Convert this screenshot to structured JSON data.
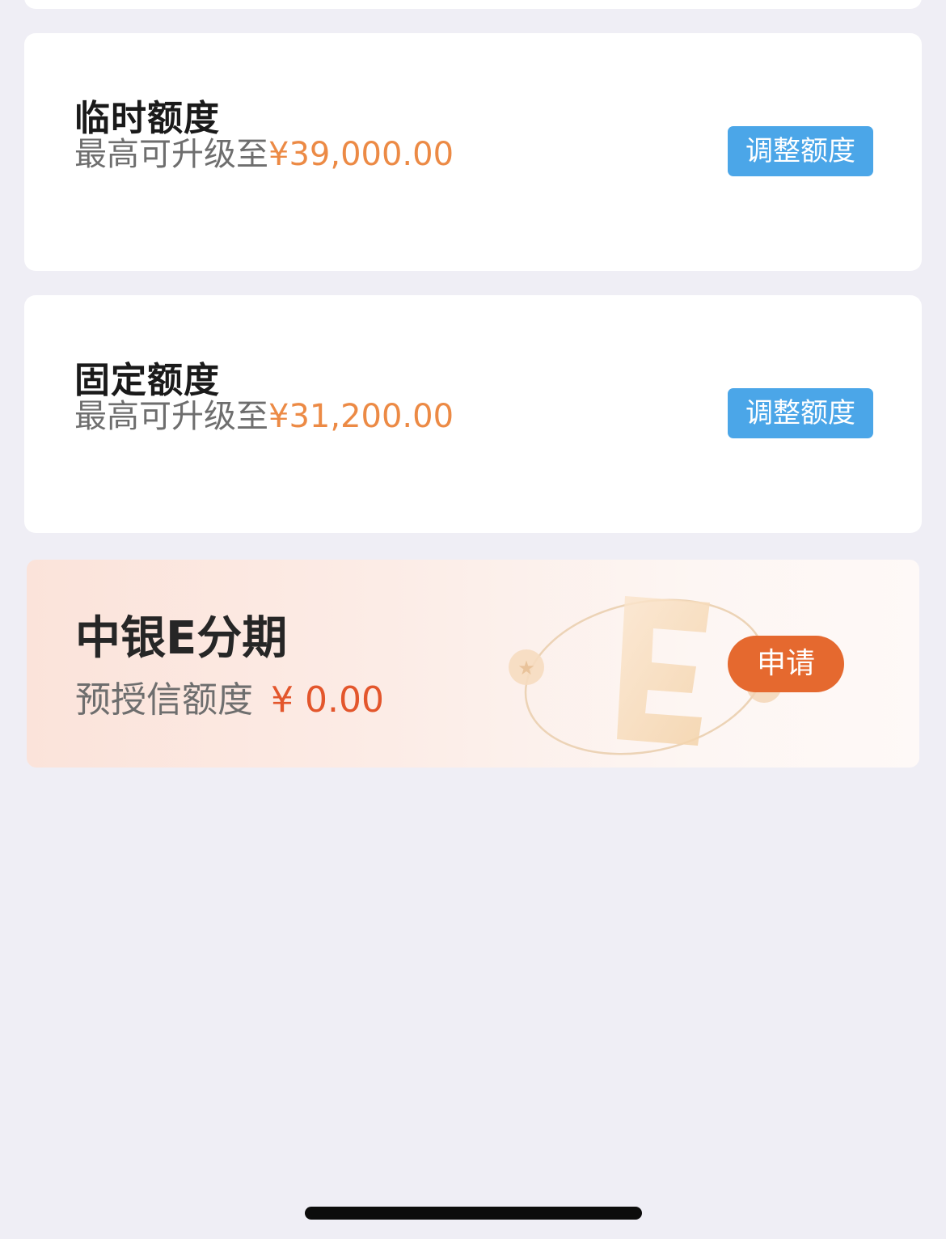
{
  "temporary_limit": {
    "title": "临时额度",
    "prefix": "最高可升级至",
    "amount": "¥39,000.00",
    "button_label": "调整额度"
  },
  "fixed_limit": {
    "title": "固定额度",
    "prefix": "最高可升级至",
    "amount": "¥31,200.00",
    "button_label": "调整额度"
  },
  "installment": {
    "title": "中银E分期",
    "label": "预授信额度",
    "amount": "¥ 0.00",
    "button_label": "申请"
  },
  "colors": {
    "accent_orange": "#ec8a45",
    "button_blue": "#4ba6e8",
    "apply_orange": "#e5692f",
    "amount_red": "#e3562c",
    "background": "#efeef5"
  }
}
